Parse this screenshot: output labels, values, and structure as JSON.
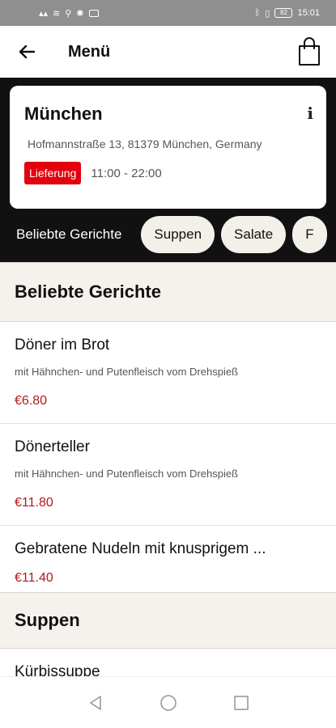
{
  "status_bar": {
    "time": "15:01",
    "battery": "82"
  },
  "app_bar": {
    "title": "Menü"
  },
  "store": {
    "name": "München",
    "address": "Hofmannstraße 13, 81379 München, Germany",
    "badge": "Lieferung",
    "hours": "11:00 - 22:00",
    "info_icon": "i"
  },
  "categories": [
    "Beliebte Gerichte",
    "Suppen",
    "Salate",
    "F"
  ],
  "sections": [
    {
      "title": "Beliebte Gerichte",
      "items": [
        {
          "name": "Döner im Brot",
          "description": "mit Hähnchen- und Putenfleisch vom Drehspieß",
          "price": "€6.80"
        },
        {
          "name": "Dönerteller",
          "description": "mit Hähnchen- und Putenfleisch vom Drehspieß",
          "price": "€11.80"
        },
        {
          "name": "Gebratene Nudeln mit knusprigem ...",
          "price": "€11.40"
        }
      ]
    },
    {
      "title": "Suppen",
      "items": [
        {
          "name": "Kürbissuppe"
        }
      ]
    }
  ],
  "colors": {
    "accent_red": "#e3000f",
    "price_red": "#b01a1a",
    "dark_bg": "#111111",
    "section_bg": "#f5f2ee"
  }
}
